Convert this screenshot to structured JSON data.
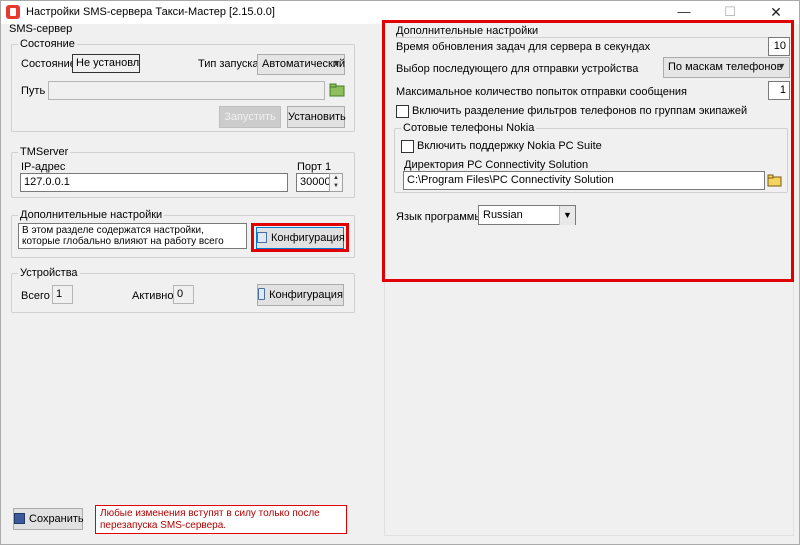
{
  "window": {
    "title": "Настройки SMS-сервера Такси-Мастер [2.15.0.0]",
    "controls": {
      "minimize": "—",
      "maximize": "☐",
      "close": "✕"
    }
  },
  "sms_server": {
    "title": "SMS-сервер",
    "state_group": {
      "title": "Состояние",
      "state_label": "Состояние",
      "state_value": "Не установлен",
      "launch_type_label": "Тип запуска",
      "launch_type_value": "Автоматический",
      "path_label": "Путь",
      "path_value": "",
      "start_button": "Запустить",
      "install_button": "Установить"
    },
    "tmserver_group": {
      "title": "TMServer",
      "ip_label": "IP-адрес",
      "ip_value": "127.0.0.1",
      "port_label": "Порт 1",
      "port_value": "30000"
    },
    "extra_group": {
      "title": "Дополнительные настройки",
      "description": "В этом разделе содержатся настройки, которые глобально влияют на работу всего SMS-сервера.",
      "config_button": "Конфигурация"
    },
    "devices_group": {
      "title": "Устройства",
      "total_label": "Всего",
      "total_value": "1",
      "active_label": "Активно",
      "active_value": "0",
      "config_button": "Конфигурация"
    },
    "save_button": "Сохранить",
    "restart_note": "Любые изменения вступят в силу только после перезапуска SMS-сервера."
  },
  "additional_settings": {
    "title": "Дополнительные настройки",
    "update_interval_label": "Время обновления задач для сервера в секундах",
    "update_interval_value": "10",
    "next_device_label": "Выбор последующего для отправки устройства",
    "next_device_value": "По маскам телефонов",
    "max_attempts_label": "Максимальное количество попыток отправки сообщения",
    "max_attempts_value": "1",
    "split_filters_label": "Включить разделение фильтров телефонов по группам экипажей",
    "split_filters_checked": false,
    "nokia_group": {
      "title": "Сотовые телефоны Nokia",
      "enable_label": "Включить поддержку Nokia PC Suite",
      "enable_checked": false,
      "dir_label": "Директория PC Connectivity Solution",
      "dir_value": "C:\\Program Files\\PC Connectivity Solution"
    },
    "language_label": "Язык программы",
    "language_value": "Russian"
  },
  "colors": {
    "highlight": "#e00000",
    "window_bg": "#f0f0f0",
    "note_text": "#b00000"
  }
}
